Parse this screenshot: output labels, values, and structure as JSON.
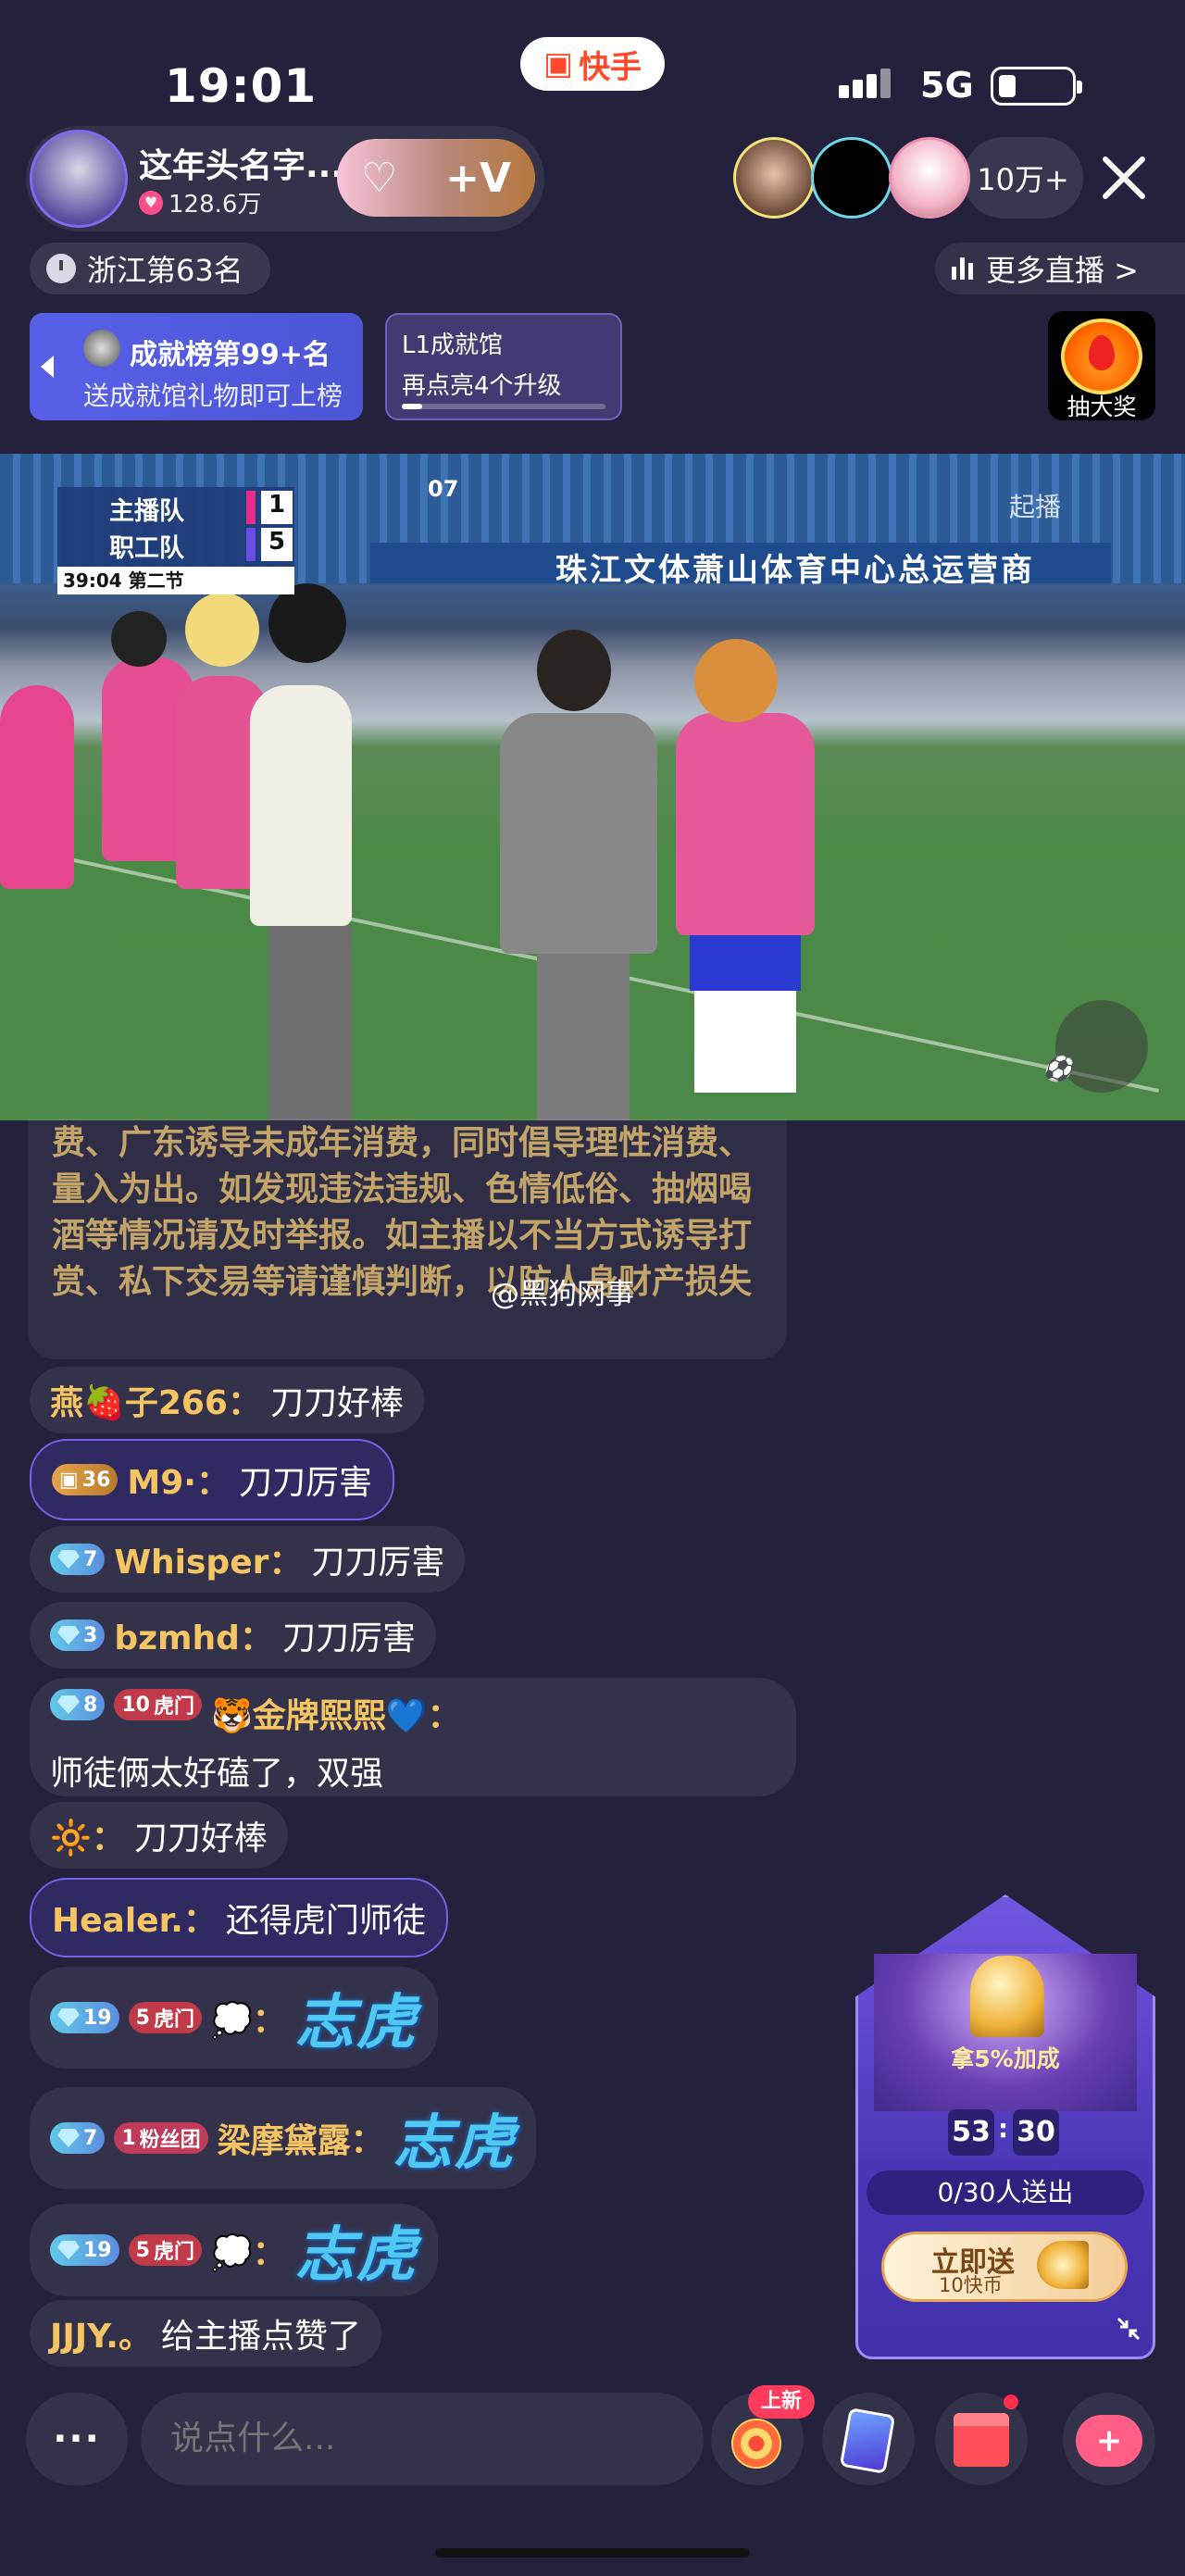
{
  "status_bar": {
    "time": "19:01",
    "app_name": "快手",
    "network": "5G"
  },
  "anchor": {
    "name": "这年头名字...",
    "likes": "128.6万",
    "follow_icon": "+V"
  },
  "viewers": {
    "count": "10万+"
  },
  "rank": {
    "label": "浙江第63名"
  },
  "more_live": {
    "label": "更多直播 >"
  },
  "achievement": {
    "title": "成就榜第99+名",
    "subtitle": "送成就馆礼物即可上榜"
  },
  "level": {
    "title": "L1成就馆",
    "subtitle": "再点亮4个升级",
    "progress": 0.1
  },
  "lottery": {
    "label": "抽大奖"
  },
  "video": {
    "team_home": "主播队",
    "team_away": "职工队",
    "score_home": "1",
    "score_away": "5",
    "clock": "39:04  第二节",
    "banner": "珠江文体萧山体育中心总运营商",
    "jersey_top": "07",
    "watermark": "起播"
  },
  "notice": {
    "text": "费、广东诱导未成年消费，同时倡导理性消费、量入为出。如发现违法违规、色情低俗、抽烟喝酒等情况请及时举报。如主播以不当方式诱导打赏、私下交易等请谨慎判断，以防人身财产损失",
    "watermark": "@黑狗网事"
  },
  "messages": [
    {
      "name": "燕🍓子266：",
      "text": "刀刀好棒"
    },
    {
      "badge": "36",
      "name": "M9·：",
      "text": "刀刀厉害"
    },
    {
      "badge": "7",
      "name": "Whisper：",
      "text": "刀刀厉害"
    },
    {
      "badge": "3",
      "name": "bzmhd：",
      "text": "刀刀厉害"
    },
    {
      "badge": "8",
      "team_level": "10",
      "team": "虎门",
      "name": "🐯金牌熙熙💙：",
      "text": "师徒俩太好磕了，双强"
    },
    {
      "name": "🔆：",
      "text": "刀刀好棒"
    },
    {
      "name": "Healer.：",
      "text": "还得虎门师徒"
    },
    {
      "badge": "19",
      "team_level": "5",
      "team": "虎门",
      "name": "💭：",
      "text": "志虎"
    },
    {
      "badge": "7",
      "team_level": "1",
      "team": "粉丝团",
      "name": "梁摩黛露：",
      "text": "志虎"
    },
    {
      "badge": "19",
      "team_level": "5",
      "team": "虎门",
      "name": "💭：",
      "text": "志虎"
    },
    {
      "name": "JJJY.。",
      "text": "给主播点赞了"
    }
  ],
  "gift_card": {
    "bonus": "拿5%加成",
    "minutes": "53",
    "seconds": "30",
    "progress": "0/30人送出",
    "send_label": "立即送",
    "price": "10快币"
  },
  "bottom_bar": {
    "more": "···",
    "placeholder": "说点什么...",
    "new_badge": "上新"
  },
  "colors": {
    "background": "#23213b",
    "name_gold": "#f6c563",
    "accent_purple": "#6b55d8"
  }
}
